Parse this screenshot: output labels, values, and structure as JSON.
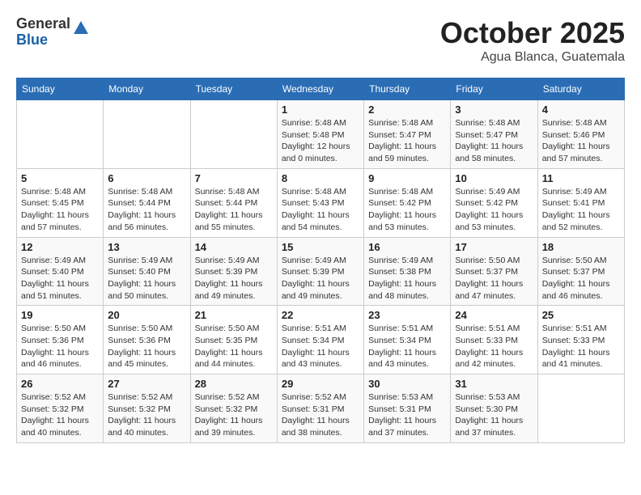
{
  "header": {
    "logo_general": "General",
    "logo_blue": "Blue",
    "month": "October 2025",
    "location": "Agua Blanca, Guatemala"
  },
  "weekdays": [
    "Sunday",
    "Monday",
    "Tuesday",
    "Wednesday",
    "Thursday",
    "Friday",
    "Saturday"
  ],
  "weeks": [
    [
      {
        "day": "",
        "info": ""
      },
      {
        "day": "",
        "info": ""
      },
      {
        "day": "",
        "info": ""
      },
      {
        "day": "1",
        "info": "Sunrise: 5:48 AM\nSunset: 5:48 PM\nDaylight: 12 hours\nand 0 minutes."
      },
      {
        "day": "2",
        "info": "Sunrise: 5:48 AM\nSunset: 5:47 PM\nDaylight: 11 hours\nand 59 minutes."
      },
      {
        "day": "3",
        "info": "Sunrise: 5:48 AM\nSunset: 5:47 PM\nDaylight: 11 hours\nand 58 minutes."
      },
      {
        "day": "4",
        "info": "Sunrise: 5:48 AM\nSunset: 5:46 PM\nDaylight: 11 hours\nand 57 minutes."
      }
    ],
    [
      {
        "day": "5",
        "info": "Sunrise: 5:48 AM\nSunset: 5:45 PM\nDaylight: 11 hours\nand 57 minutes."
      },
      {
        "day": "6",
        "info": "Sunrise: 5:48 AM\nSunset: 5:44 PM\nDaylight: 11 hours\nand 56 minutes."
      },
      {
        "day": "7",
        "info": "Sunrise: 5:48 AM\nSunset: 5:44 PM\nDaylight: 11 hours\nand 55 minutes."
      },
      {
        "day": "8",
        "info": "Sunrise: 5:48 AM\nSunset: 5:43 PM\nDaylight: 11 hours\nand 54 minutes."
      },
      {
        "day": "9",
        "info": "Sunrise: 5:48 AM\nSunset: 5:42 PM\nDaylight: 11 hours\nand 53 minutes."
      },
      {
        "day": "10",
        "info": "Sunrise: 5:49 AM\nSunset: 5:42 PM\nDaylight: 11 hours\nand 53 minutes."
      },
      {
        "day": "11",
        "info": "Sunrise: 5:49 AM\nSunset: 5:41 PM\nDaylight: 11 hours\nand 52 minutes."
      }
    ],
    [
      {
        "day": "12",
        "info": "Sunrise: 5:49 AM\nSunset: 5:40 PM\nDaylight: 11 hours\nand 51 minutes."
      },
      {
        "day": "13",
        "info": "Sunrise: 5:49 AM\nSunset: 5:40 PM\nDaylight: 11 hours\nand 50 minutes."
      },
      {
        "day": "14",
        "info": "Sunrise: 5:49 AM\nSunset: 5:39 PM\nDaylight: 11 hours\nand 49 minutes."
      },
      {
        "day": "15",
        "info": "Sunrise: 5:49 AM\nSunset: 5:39 PM\nDaylight: 11 hours\nand 49 minutes."
      },
      {
        "day": "16",
        "info": "Sunrise: 5:49 AM\nSunset: 5:38 PM\nDaylight: 11 hours\nand 48 minutes."
      },
      {
        "day": "17",
        "info": "Sunrise: 5:50 AM\nSunset: 5:37 PM\nDaylight: 11 hours\nand 47 minutes."
      },
      {
        "day": "18",
        "info": "Sunrise: 5:50 AM\nSunset: 5:37 PM\nDaylight: 11 hours\nand 46 minutes."
      }
    ],
    [
      {
        "day": "19",
        "info": "Sunrise: 5:50 AM\nSunset: 5:36 PM\nDaylight: 11 hours\nand 46 minutes."
      },
      {
        "day": "20",
        "info": "Sunrise: 5:50 AM\nSunset: 5:36 PM\nDaylight: 11 hours\nand 45 minutes."
      },
      {
        "day": "21",
        "info": "Sunrise: 5:50 AM\nSunset: 5:35 PM\nDaylight: 11 hours\nand 44 minutes."
      },
      {
        "day": "22",
        "info": "Sunrise: 5:51 AM\nSunset: 5:34 PM\nDaylight: 11 hours\nand 43 minutes."
      },
      {
        "day": "23",
        "info": "Sunrise: 5:51 AM\nSunset: 5:34 PM\nDaylight: 11 hours\nand 43 minutes."
      },
      {
        "day": "24",
        "info": "Sunrise: 5:51 AM\nSunset: 5:33 PM\nDaylight: 11 hours\nand 42 minutes."
      },
      {
        "day": "25",
        "info": "Sunrise: 5:51 AM\nSunset: 5:33 PM\nDaylight: 11 hours\nand 41 minutes."
      }
    ],
    [
      {
        "day": "26",
        "info": "Sunrise: 5:52 AM\nSunset: 5:32 PM\nDaylight: 11 hours\nand 40 minutes."
      },
      {
        "day": "27",
        "info": "Sunrise: 5:52 AM\nSunset: 5:32 PM\nDaylight: 11 hours\nand 40 minutes."
      },
      {
        "day": "28",
        "info": "Sunrise: 5:52 AM\nSunset: 5:32 PM\nDaylight: 11 hours\nand 39 minutes."
      },
      {
        "day": "29",
        "info": "Sunrise: 5:52 AM\nSunset: 5:31 PM\nDaylight: 11 hours\nand 38 minutes."
      },
      {
        "day": "30",
        "info": "Sunrise: 5:53 AM\nSunset: 5:31 PM\nDaylight: 11 hours\nand 37 minutes."
      },
      {
        "day": "31",
        "info": "Sunrise: 5:53 AM\nSunset: 5:30 PM\nDaylight: 11 hours\nand 37 minutes."
      },
      {
        "day": "",
        "info": ""
      }
    ]
  ]
}
